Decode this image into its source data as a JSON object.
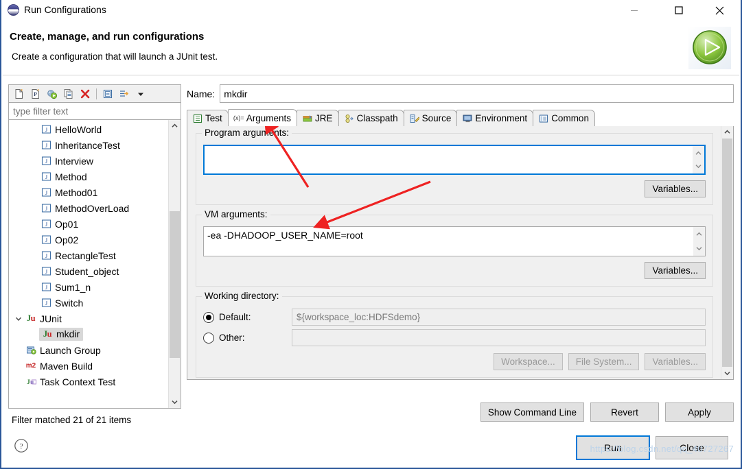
{
  "window": {
    "title": "Run Configurations",
    "app_icon": "eclipse-icon",
    "controls": {
      "minimize": "minimize-icon",
      "maximize": "maximize-icon",
      "close": "close-icon"
    }
  },
  "header": {
    "title": "Create, manage, and run configurations",
    "subtitle": "Create a configuration that will launch a JUnit test.",
    "badge_icon": "run-green-play-icon"
  },
  "tree_panel": {
    "toolbar": [
      {
        "name": "new-configuration-icon",
        "title": "New launch configuration"
      },
      {
        "name": "new-prototype-icon",
        "title": "New prototype"
      },
      {
        "name": "export-icon",
        "title": "Export"
      },
      {
        "name": "duplicate-icon",
        "title": "Duplicate"
      },
      {
        "name": "delete-icon",
        "title": "Delete"
      },
      {
        "name": "collapse-all-icon",
        "title": "Collapse All"
      },
      {
        "name": "filter-icon",
        "title": "Filter"
      },
      {
        "name": "chevron-down-icon",
        "title": "View Menu"
      }
    ],
    "filter": {
      "placeholder": "type filter text",
      "value": ""
    },
    "items": [
      {
        "label": "HelloWorld",
        "icon": "java-applet-icon",
        "depth": 2,
        "selected": false
      },
      {
        "label": "InheritanceTest",
        "icon": "java-applet-icon",
        "depth": 2,
        "selected": false
      },
      {
        "label": "Interview",
        "icon": "java-applet-icon",
        "depth": 2,
        "selected": false
      },
      {
        "label": "Method",
        "icon": "java-applet-icon",
        "depth": 2,
        "selected": false
      },
      {
        "label": "Method01",
        "icon": "java-applet-icon",
        "depth": 2,
        "selected": false
      },
      {
        "label": "MethodOverLoad",
        "icon": "java-applet-icon",
        "depth": 2,
        "selected": false
      },
      {
        "label": "Op01",
        "icon": "java-applet-icon",
        "depth": 2,
        "selected": false
      },
      {
        "label": "Op02",
        "icon": "java-applet-icon",
        "depth": 2,
        "selected": false
      },
      {
        "label": "RectangleTest",
        "icon": "java-applet-icon",
        "depth": 2,
        "selected": false
      },
      {
        "label": "Student_object",
        "icon": "java-applet-icon",
        "depth": 2,
        "selected": false
      },
      {
        "label": "Sum1_n",
        "icon": "java-applet-icon",
        "depth": 2,
        "selected": false
      },
      {
        "label": "Switch",
        "icon": "java-applet-icon",
        "depth": 2,
        "selected": false
      },
      {
        "label": "JUnit",
        "icon": "junit-icon",
        "depth": 1,
        "selected": false,
        "expanded": true
      },
      {
        "label": "mkdir",
        "icon": "junit-icon",
        "depth": 2,
        "selected": true
      },
      {
        "label": "Launch Group",
        "icon": "launch-group-icon",
        "depth": 1,
        "selected": false
      },
      {
        "label": "Maven Build",
        "icon": "maven-icon",
        "depth": 1,
        "selected": false
      },
      {
        "label": "Task Context Test",
        "icon": "task-context-test-icon",
        "depth": 1,
        "selected": false
      }
    ],
    "status": "Filter matched 21 of 21 items"
  },
  "config": {
    "name_label": "Name:",
    "name_value": "mkdir",
    "tabs": [
      {
        "label": "Test",
        "icon": "test-icon",
        "active": false
      },
      {
        "label": "Arguments",
        "icon": "arguments-icon",
        "active": true
      },
      {
        "label": "JRE",
        "icon": "jre-icon",
        "active": false
      },
      {
        "label": "Classpath",
        "icon": "classpath-icon",
        "active": false
      },
      {
        "label": "Source",
        "icon": "source-icon",
        "active": false
      },
      {
        "label": "Environment",
        "icon": "environment-icon",
        "active": false
      },
      {
        "label": "Common",
        "icon": "common-icon",
        "active": false
      }
    ],
    "program_arguments": {
      "label": "Program arguments:",
      "value": "",
      "variables_button": "Variables..."
    },
    "vm_arguments": {
      "label": "VM arguments:",
      "value": "-ea -DHADOOP_USER_NAME=root",
      "variables_button": "Variables..."
    },
    "working_directory": {
      "label": "Working directory:",
      "default_label": "Default:",
      "default_value": "${workspace_loc:HDFSdemo}",
      "default_selected": true,
      "other_label": "Other:",
      "other_value": "",
      "other_selected": false,
      "workspace_button": "Workspace...",
      "file_system_button": "File System...",
      "variables_button": "Variables..."
    },
    "actions": {
      "show_command_line": "Show Command Line",
      "revert": "Revert",
      "apply": "Apply"
    }
  },
  "footer": {
    "help_icon": "help-icon",
    "run": "Run",
    "close": "Close",
    "watermark": "https://blog.csdn.net/qq_40727267"
  },
  "colors": {
    "accent": "#0078d7",
    "annotation": "#ee2222",
    "title_border": "#2a5699",
    "panel": "#f0f0f0"
  }
}
